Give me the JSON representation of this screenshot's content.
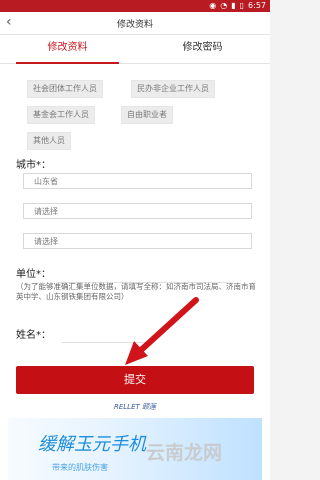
{
  "status_bar": {
    "time": "6:57"
  },
  "header": {
    "title": "修改资料",
    "back_icon": "back-icon"
  },
  "tabs": [
    {
      "label": "修改资料",
      "active": true
    },
    {
      "label": "修改密码",
      "active": false
    }
  ],
  "industry_options": [
    "社会团体工作人员",
    "民办非企业工作人员",
    "基金会工作人员",
    "自由职业者",
    "其他人员"
  ],
  "city": {
    "label": "城市*：",
    "province": "山东省",
    "city_placeholder": "请选择",
    "district_placeholder": "请选择"
  },
  "unit": {
    "label": "单位*：",
    "hint": "（为了能够准确汇集单位数据，请填写全称：如济南市司法局、济南市育英中学、山东钢铁集团有限公司）"
  },
  "name": {
    "label": "姓名*："
  },
  "submit_label": "提交",
  "ad": {
    "brand": "RELLET 颐莲",
    "headline": "缓解玉元手机",
    "subline": "带来的肌肤伤害"
  },
  "watermark": "云南龙网",
  "colors": {
    "accent": "#c40f14",
    "status_bar": "#b81b21"
  }
}
